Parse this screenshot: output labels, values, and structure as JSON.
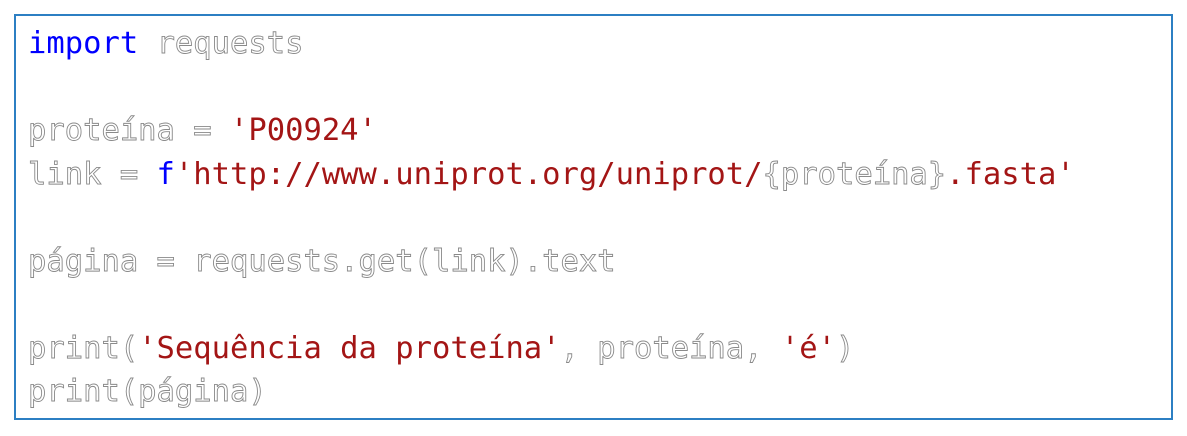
{
  "code_lines": [
    [
      {
        "t": "import",
        "c": "kw"
      },
      {
        "t": " ",
        "c": "pl"
      },
      {
        "t": "requests",
        "c": "pl"
      }
    ],
    [],
    [
      {
        "t": "proteína = ",
        "c": "pl"
      },
      {
        "t": "'P00924'",
        "c": "st"
      }
    ],
    [
      {
        "t": "link = ",
        "c": "pl"
      },
      {
        "t": "f",
        "c": "kw"
      },
      {
        "t": "'http://www.uniprot.org/uniprot/",
        "c": "st"
      },
      {
        "t": "{proteína}",
        "c": "pl"
      },
      {
        "t": ".fasta'",
        "c": "st"
      }
    ],
    [],
    [
      {
        "t": "página = requests.get(link).text",
        "c": "pl"
      }
    ],
    [],
    [
      {
        "t": "print(",
        "c": "pl"
      },
      {
        "t": "'Sequência da proteína'",
        "c": "st"
      },
      {
        "t": ", proteína, ",
        "c": "pl"
      },
      {
        "t": "'é'",
        "c": "st"
      },
      {
        "t": ")",
        "c": "pl"
      }
    ],
    [
      {
        "t": "print(página)",
        "c": "pl"
      }
    ]
  ],
  "colors": {
    "border": "#2c7fc3",
    "keyword": "#0000ff",
    "string": "#a31515",
    "identifier_outline": "#8a8a8a"
  }
}
